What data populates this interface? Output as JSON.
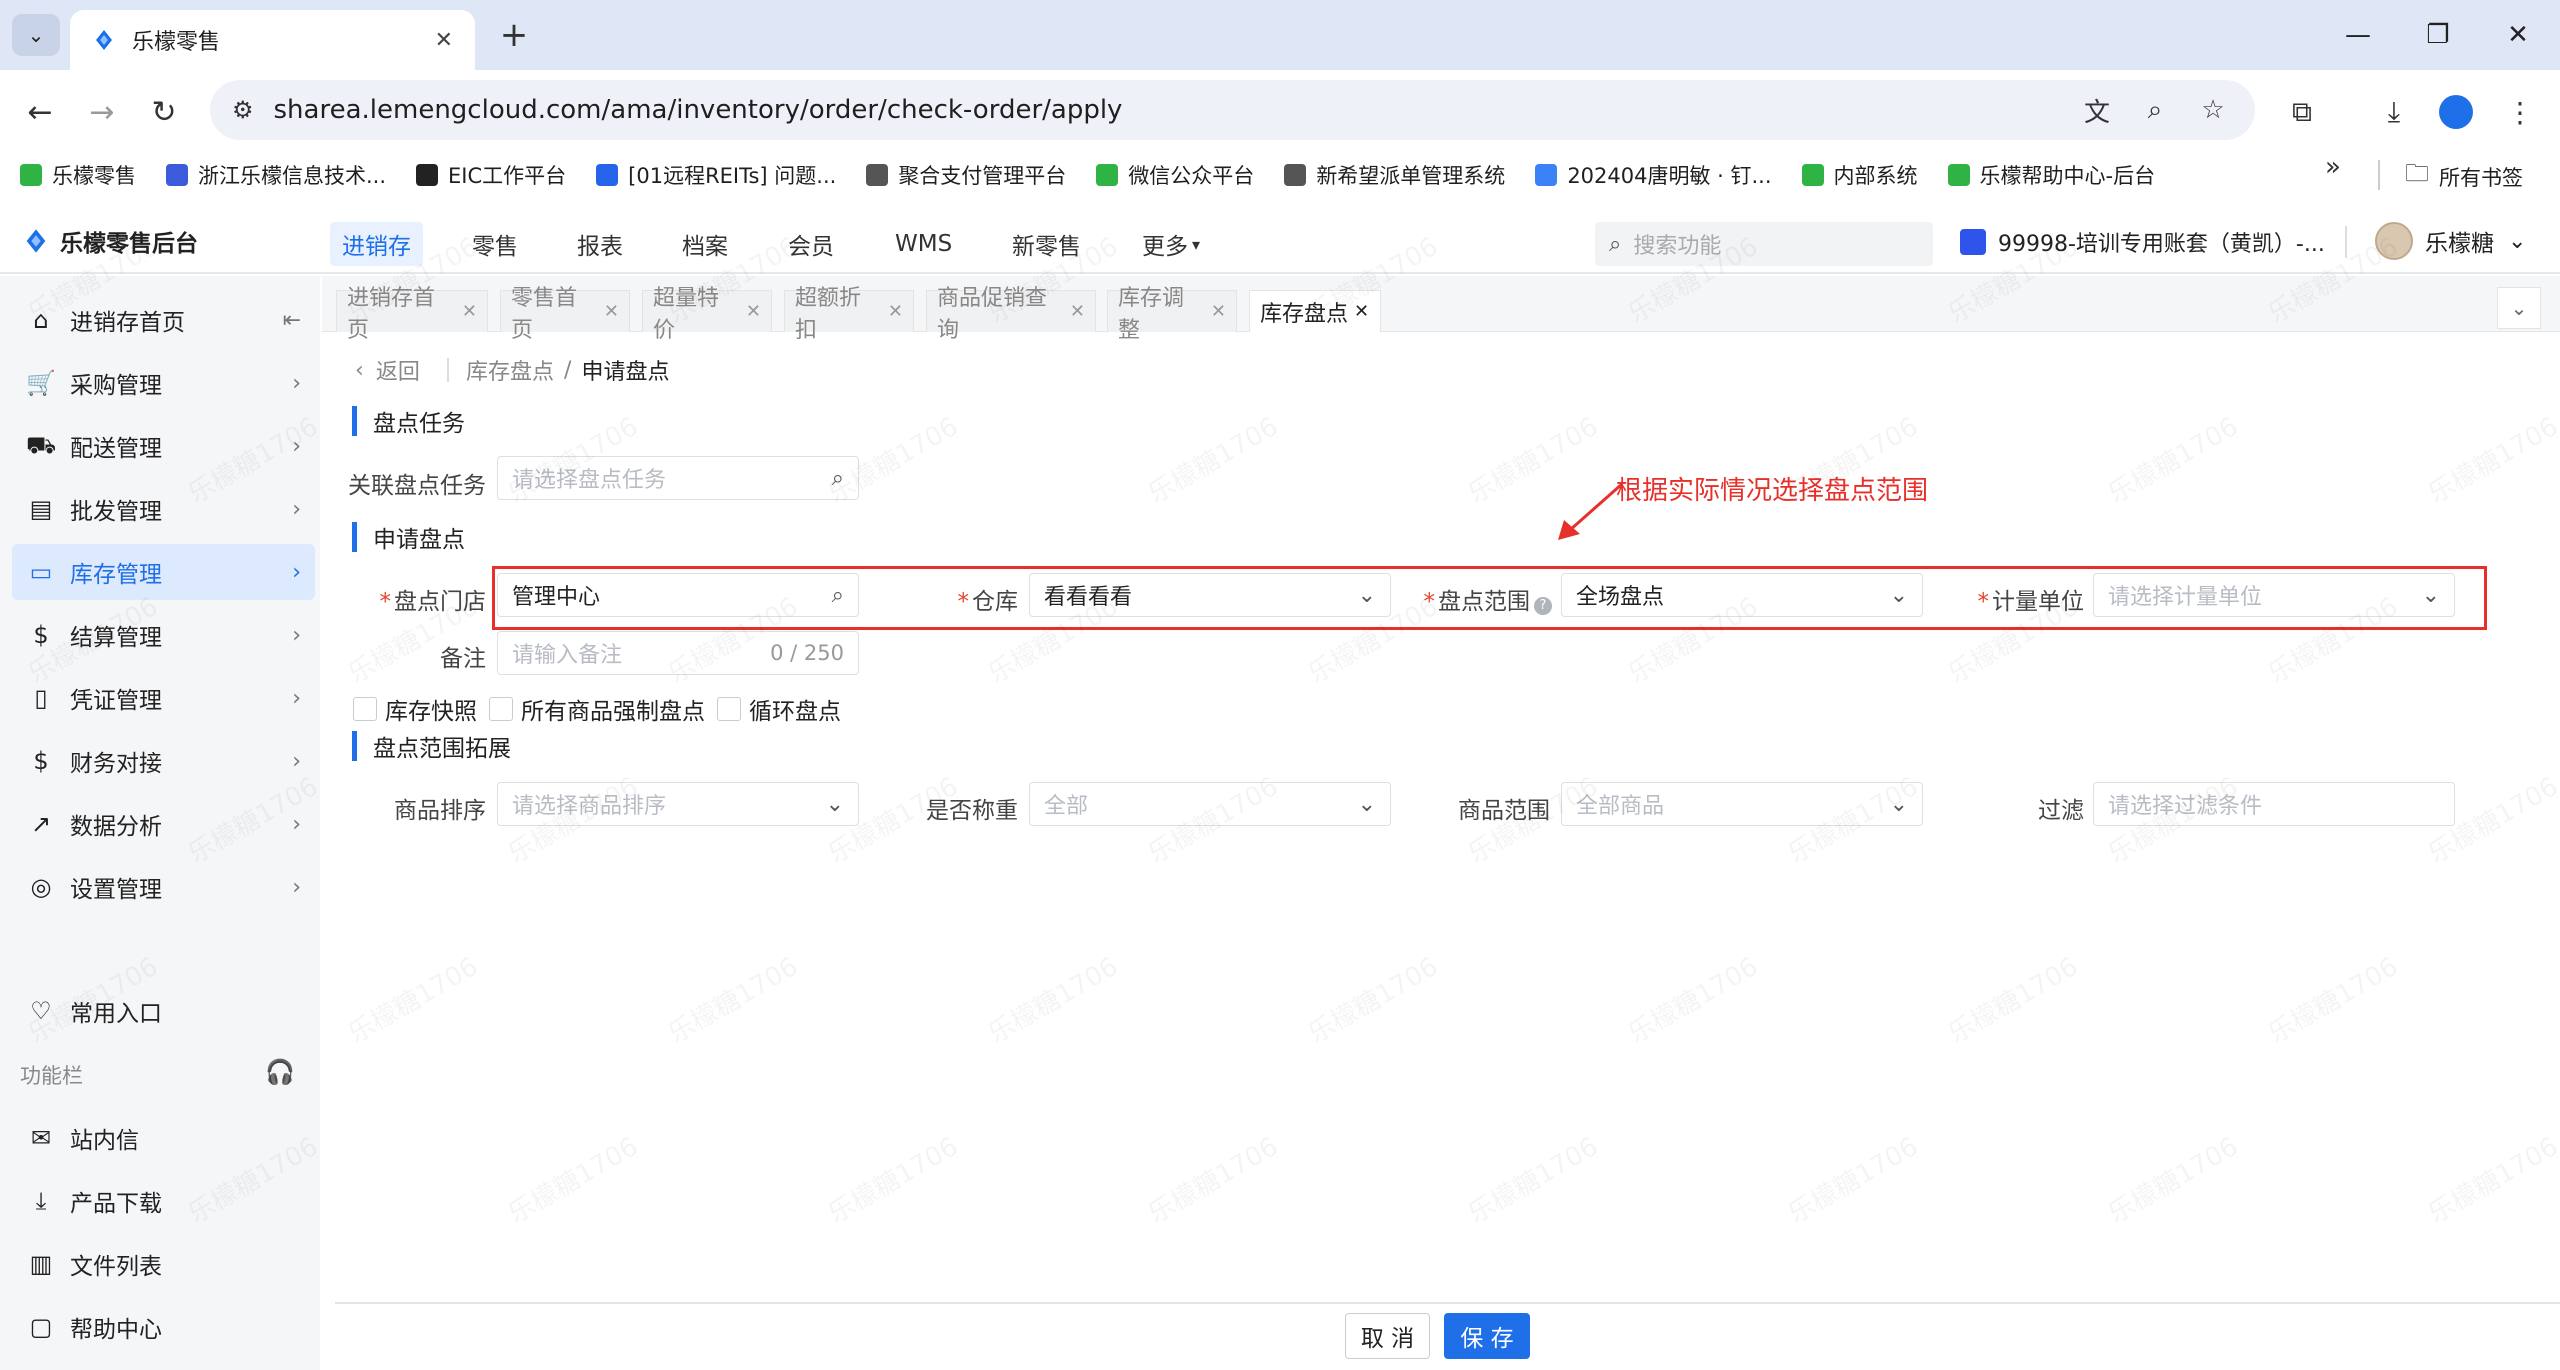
{
  "browser": {
    "tab_title": "乐檬零售",
    "url": "sharea.lemengcloud.com/ama/inventory/order/check-order/apply",
    "bookmarks": [
      {
        "label": "乐檬零售",
        "icon": "lemon-icon",
        "color": "#2fb344"
      },
      {
        "label": "浙江乐檬信息技术...",
        "icon": "company-icon",
        "color": "#3b5bdb"
      },
      {
        "label": "EIC工作平台",
        "icon": "eic-icon",
        "color": "#222222"
      },
      {
        "label": "[01远程REITs] 问题...",
        "icon": "jira-icon",
        "color": "#2563eb"
      },
      {
        "label": "聚合支付管理平台",
        "icon": "globe-icon",
        "color": "#555555"
      },
      {
        "label": "微信公众平台",
        "icon": "wechat-icon",
        "color": "#2fb344"
      },
      {
        "label": "新希望派单管理系统",
        "icon": "globe-icon",
        "color": "#555555"
      },
      {
        "label": "202404唐明敏 · 钉...",
        "icon": "doc-icon",
        "color": "#3b82f6"
      },
      {
        "label": "内部系统",
        "icon": "lemon-icon",
        "color": "#2fb344"
      },
      {
        "label": "乐檬帮助中心-后台",
        "icon": "help-center-icon",
        "color": "#2fb344"
      }
    ],
    "all_bookmarks": "所有书签"
  },
  "header": {
    "logo": "乐檬零售后台",
    "nav": [
      "进销存",
      "零售",
      "报表",
      "档案",
      "会员",
      "WMS",
      "新零售",
      "更多"
    ],
    "search_placeholder": "搜索功能",
    "account": "99998-培训专用账套（黄凯）-...",
    "user": "乐檬糖"
  },
  "sidebar": {
    "items": [
      {
        "label": "进销存首页",
        "icon": "home-icon",
        "glyph": "⌂"
      },
      {
        "label": "采购管理",
        "icon": "cart-icon",
        "glyph": "🛒"
      },
      {
        "label": "配送管理",
        "icon": "delivery-icon",
        "glyph": "⛟"
      },
      {
        "label": "批发管理",
        "icon": "wholesale-icon",
        "glyph": "▤"
      },
      {
        "label": "库存管理",
        "icon": "inventory-icon",
        "glyph": "▭"
      },
      {
        "label": "结算管理",
        "icon": "settlement-icon",
        "glyph": "$"
      },
      {
        "label": "凭证管理",
        "icon": "voucher-icon",
        "glyph": "▯"
      },
      {
        "label": "财务对接",
        "icon": "finance-icon",
        "glyph": "$"
      },
      {
        "label": "数据分析",
        "icon": "chart-icon",
        "glyph": "↗"
      },
      {
        "label": "设置管理",
        "icon": "settings-icon",
        "glyph": "◎"
      }
    ],
    "favorites": "常用入口",
    "function_bar": "功能栏",
    "tools": [
      {
        "label": "站内信",
        "icon": "mail-icon",
        "glyph": "✉"
      },
      {
        "label": "产品下载",
        "icon": "download-icon",
        "glyph": "⤓"
      },
      {
        "label": "文件列表",
        "icon": "file-list-icon",
        "glyph": "▥"
      },
      {
        "label": "帮助中心",
        "icon": "help-icon",
        "glyph": "▢"
      }
    ]
  },
  "page_tabs": [
    "进销存首页",
    "零售首页",
    "超量特价",
    "超额折扣",
    "商品促销查询",
    "库存调整",
    "库存盘点"
  ],
  "breadcrumb": {
    "back": "返回",
    "parent": "库存盘点",
    "sep": "/",
    "current": "申请盘点"
  },
  "section_task": {
    "title": "盘点任务",
    "related_label": "关联盘点任务",
    "related_placeholder": "请选择盘点任务"
  },
  "section_apply": {
    "title": "申请盘点",
    "store_label": "盘点门店",
    "store_value": "管理中心",
    "warehouse_label": "仓库",
    "warehouse_value": "看看看看",
    "scope_label": "盘点范围",
    "scope_value": "全场盘点",
    "unit_label": "计量单位",
    "unit_placeholder": "请选择计量单位",
    "remark_label": "备注",
    "remark_placeholder": "请输入备注",
    "remark_count": "0 / 250",
    "checkboxes": [
      "库存快照",
      "所有商品强制盘点",
      "循环盘点"
    ]
  },
  "section_ext": {
    "title": "盘点范围拓展",
    "sort_label": "商品排序",
    "sort_placeholder": "请选择商品排序",
    "weigh_label": "是否称重",
    "weigh_placeholder": "全部",
    "range_label": "商品范围",
    "range_placeholder": "全部商品",
    "filter_label": "过滤",
    "filter_placeholder": "请选择过滤条件"
  },
  "annotation": "根据实际情况选择盘点范围",
  "footer": {
    "cancel": "取 消",
    "save": "保 存"
  },
  "watermark": "乐檬糖1706",
  "colors": {
    "accent": "#1e6fe8",
    "annotation": "#e8302b",
    "required": "#e8432e"
  }
}
